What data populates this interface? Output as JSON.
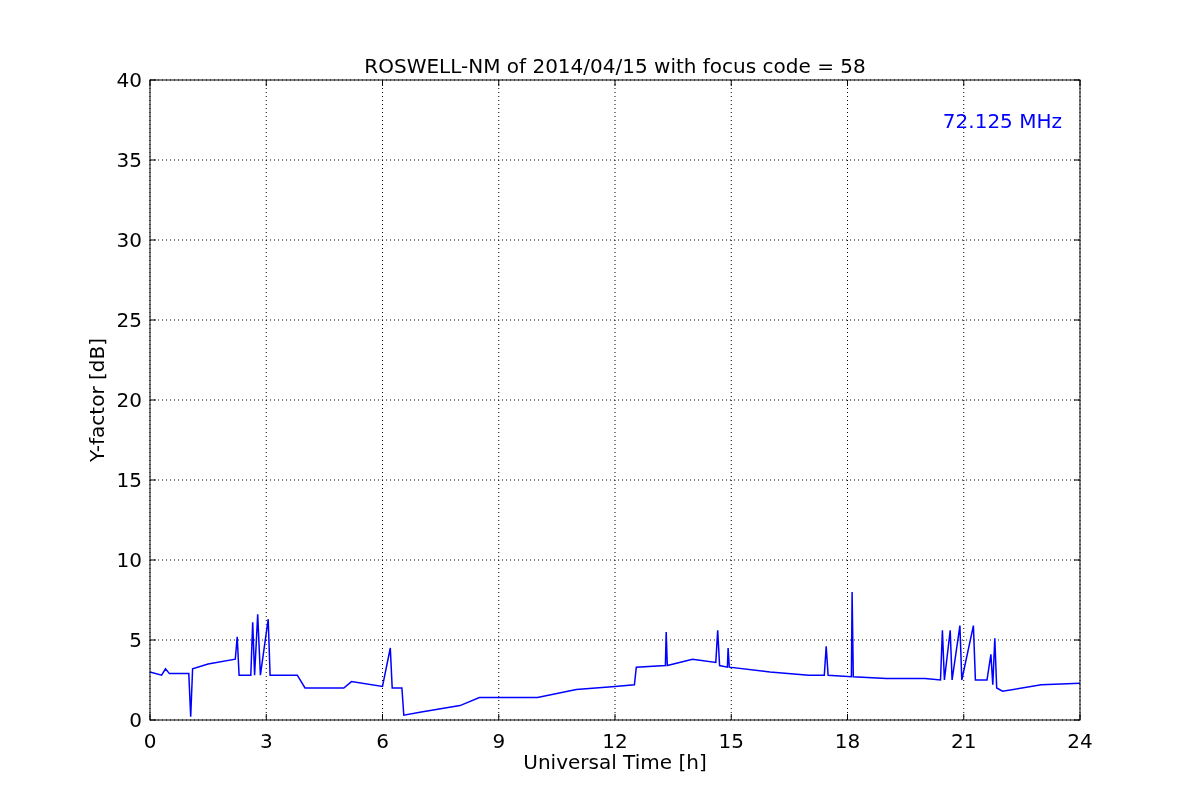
{
  "chart": {
    "chart_data": {
      "type": "line",
      "title": "ROSWELL-NM of 2014/04/15 with focus code = 58",
      "xlabel": "Universal Time [h]",
      "ylabel": "Y-factor [dB]",
      "x": [
        0,
        0.3,
        0.4,
        0.5,
        1.0,
        1.05,
        1.1,
        1.5,
        2.2,
        2.25,
        2.3,
        2.6,
        2.65,
        2.7,
        2.78,
        2.85,
        3.05,
        3.1,
        3.8,
        4.0,
        5.0,
        5.2,
        6.0,
        6.2,
        6.25,
        6.5,
        6.55,
        7.0,
        8.0,
        8.5,
        9,
        10,
        11,
        12,
        12.5,
        12.55,
        13.3,
        13.32,
        13.35,
        14,
        14.6,
        14.65,
        14.7,
        14.9,
        14.92,
        14.95,
        16,
        17,
        17.4,
        17.45,
        17.5,
        18.1,
        18.12,
        18.15,
        19,
        20,
        20.4,
        20.45,
        20.5,
        20.65,
        20.7,
        20.9,
        20.95,
        21.25,
        21.3,
        21.6,
        21.7,
        21.75,
        21.8,
        21.85,
        22,
        23,
        24
      ],
      "series": [
        {
          "name": "72.125 MHz",
          "color": "#0000ff",
          "values": [
            3.0,
            2.8,
            3.2,
            2.9,
            2.9,
            0.2,
            3.2,
            3.5,
            3.8,
            5.2,
            2.8,
            2.8,
            6.1,
            2.8,
            6.6,
            2.8,
            6.3,
            2.8,
            2.8,
            2.0,
            2.0,
            2.4,
            2.1,
            4.5,
            2.0,
            2.0,
            0.3,
            0.5,
            0.9,
            1.4,
            1.4,
            1.4,
            1.9,
            2.1,
            2.2,
            3.3,
            3.4,
            5.5,
            3.4,
            3.8,
            3.6,
            5.6,
            3.4,
            3.3,
            4.5,
            3.3,
            3.0,
            2.8,
            2.8,
            4.6,
            2.8,
            2.7,
            8.0,
            2.7,
            2.6,
            2.6,
            2.5,
            5.6,
            2.5,
            5.6,
            2.5,
            5.9,
            2.5,
            5.9,
            2.5,
            2.5,
            4.1,
            2.2,
            5.1,
            2.0,
            1.8,
            2.2,
            2.3
          ]
        }
      ],
      "xlim": [
        0,
        24
      ],
      "ylim": [
        0,
        40
      ],
      "xticks": [
        0,
        3,
        6,
        9,
        12,
        15,
        18,
        21,
        24
      ],
      "yticks": [
        0,
        5,
        10,
        15,
        20,
        25,
        30,
        35,
        40
      ],
      "grid": true
    }
  }
}
